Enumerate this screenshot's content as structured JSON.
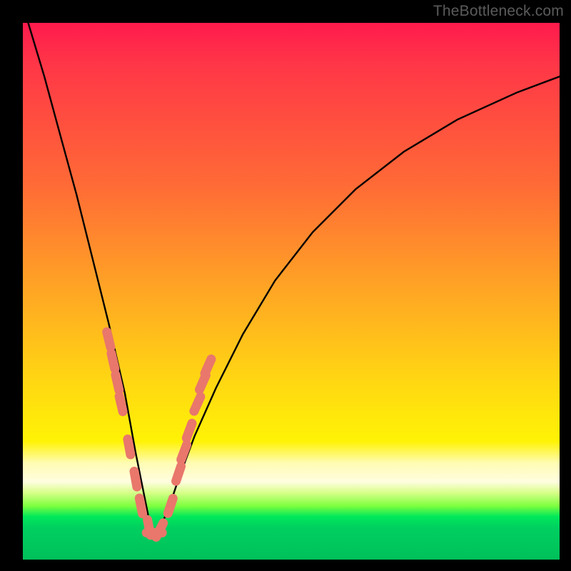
{
  "watermark": "TheBottleneck.com",
  "chart_data": {
    "type": "line",
    "title": "",
    "xlabel": "",
    "ylabel": "",
    "xlim": [
      0,
      100
    ],
    "ylim": [
      0,
      100
    ],
    "grid": false,
    "legend": false,
    "curve": {
      "description": "V-shaped bottleneck curve; minimum near x≈24",
      "x": [
        1,
        4,
        7,
        10,
        13,
        16,
        19,
        21,
        23,
        24,
        25,
        27,
        29,
        32,
        36,
        41,
        47,
        54,
        62,
        71,
        81,
        92,
        100
      ],
      "y_pct": [
        100,
        90,
        79,
        68,
        56,
        44,
        31,
        20,
        10,
        5,
        5,
        9,
        15,
        23,
        32,
        42,
        52,
        61,
        69,
        76,
        82,
        87,
        90
      ]
    },
    "markers": {
      "description": "salmon rounded-capsule dots along lower portion of both arms",
      "points": [
        {
          "x": 16.0,
          "y_pct": 41
        },
        {
          "x": 16.8,
          "y_pct": 37
        },
        {
          "x": 17.6,
          "y_pct": 33
        },
        {
          "x": 18.3,
          "y_pct": 29
        },
        {
          "x": 19.8,
          "y_pct": 21
        },
        {
          "x": 21.0,
          "y_pct": 15
        },
        {
          "x": 22.0,
          "y_pct": 10
        },
        {
          "x": 23.5,
          "y_pct": 6
        },
        {
          "x": 24.5,
          "y_pct": 5
        },
        {
          "x": 25.5,
          "y_pct": 5.5
        },
        {
          "x": 27.5,
          "y_pct": 10
        },
        {
          "x": 29.0,
          "y_pct": 16
        },
        {
          "x": 30.0,
          "y_pct": 20
        },
        {
          "x": 31.0,
          "y_pct": 24
        },
        {
          "x": 32.5,
          "y_pct": 29
        },
        {
          "x": 33.5,
          "y_pct": 33
        },
        {
          "x": 34.5,
          "y_pct": 36
        }
      ],
      "color": "#e9776b"
    },
    "curve_color": "#000000",
    "background_gradient": [
      "#ff1a4d",
      "#ff6a36",
      "#ffd513",
      "#fffcb3",
      "#00e85a"
    ]
  }
}
